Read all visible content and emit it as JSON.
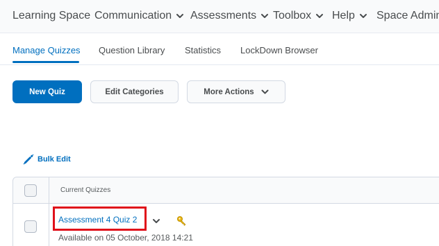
{
  "topnav": {
    "items": [
      {
        "label": "Learning Space",
        "dropdown": false
      },
      {
        "label": "Communication",
        "dropdown": true
      },
      {
        "label": "Assessments",
        "dropdown": true
      },
      {
        "label": "Toolbox",
        "dropdown": true
      },
      {
        "label": "Help",
        "dropdown": true
      },
      {
        "label": "Space Admin",
        "dropdown": false
      }
    ]
  },
  "tabs": {
    "items": [
      {
        "label": "Manage Quizzes",
        "active": true
      },
      {
        "label": "Question Library",
        "active": false
      },
      {
        "label": "Statistics",
        "active": false
      },
      {
        "label": "LockDown Browser",
        "active": false
      }
    ]
  },
  "toolbar": {
    "new_quiz": "New Quiz",
    "edit_categories": "Edit Categories",
    "more_actions": "More Actions"
  },
  "bulk_edit": {
    "label": "Bulk Edit",
    "icon": "pencil-icon"
  },
  "table": {
    "header": "Current Quizzes",
    "rows": [
      {
        "title": "Assessment 4 Quiz 2",
        "availability": "Available on 05 October, 2018 14:21",
        "icons": [
          "chevron-down-icon",
          "key-icon"
        ]
      }
    ]
  },
  "colors": {
    "brand_blue": "#006fbf",
    "highlight_red": "#e0101a",
    "key_gold": "#e8b410"
  }
}
